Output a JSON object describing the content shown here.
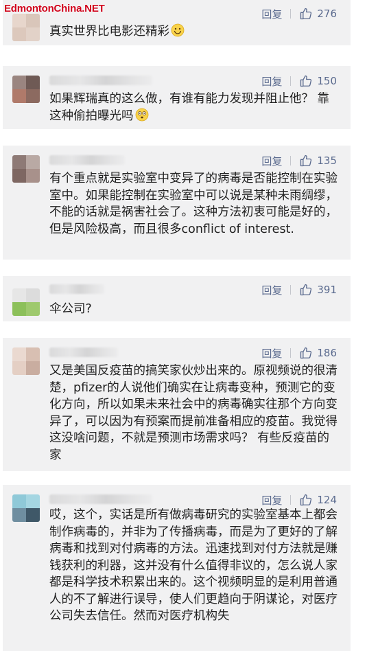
{
  "watermark": "EdmontonChina.NET",
  "comments": [
    {
      "reply_label": "回复",
      "likes": "276",
      "text": "真实世界比电影还精彩"
    },
    {
      "reply_label": "回复",
      "likes": "150",
      "text": "如果辉瑞真的这么做，有谁有能力发现并阻止他？ 靠这种偷拍曝光吗"
    },
    {
      "reply_label": "回复",
      "likes": "135",
      "text": "有个重点就是实验室中变异了的病毒是否能控制在实验室中。如果能控制在实验室中可以说是某种未雨绸缪，不能的话就是祸害社会了。这种方法初衷可能是好的，但是风险极高，而且很多conflict of interest."
    },
    {
      "reply_label": "回复",
      "likes": "391",
      "text": "伞公司?"
    },
    {
      "reply_label": "回复",
      "likes": "186",
      "text": "又是美国反疫苗的搞笑家伙炒出来的。原视频说的很清楚，pfizer的人说他们确实在让病毒变种，预测它的变化方向，所以如果未来社会中的病毒确实往那个方向变异了，可以因为有预案而提前准备相应的疫苗。我觉得这没啥问题，不就是预测市场需求吗？ 有些反疫苗的家"
    },
    {
      "reply_label": "回复",
      "likes": "124",
      "text": "哎，这个，实话是所有做病毒研究的实验室基本上都会制作病毒的，并非为了传播病毒，而是为了更好的了解病毒和找到对付病毒的方法。迅速找到对付方法就是赚钱获利的利器，这并没有什么值得非议的，怎么说人家都是科学技术积累出来的。这个视频明显的是利用普通人的不了解进行误导，使人们更趋向于阴谋论，对医疗公司失去信任。然而对医疗机构失"
    }
  ],
  "icons": {
    "like": "thumbs-up-icon",
    "emoji_smile": "smile-emoji-icon",
    "emoji_surprised": "surprised-emoji-icon"
  },
  "colors": {
    "card_bg": "#f1f1f2",
    "action_text": "#5a6a8e",
    "watermark": "#d0021b"
  }
}
